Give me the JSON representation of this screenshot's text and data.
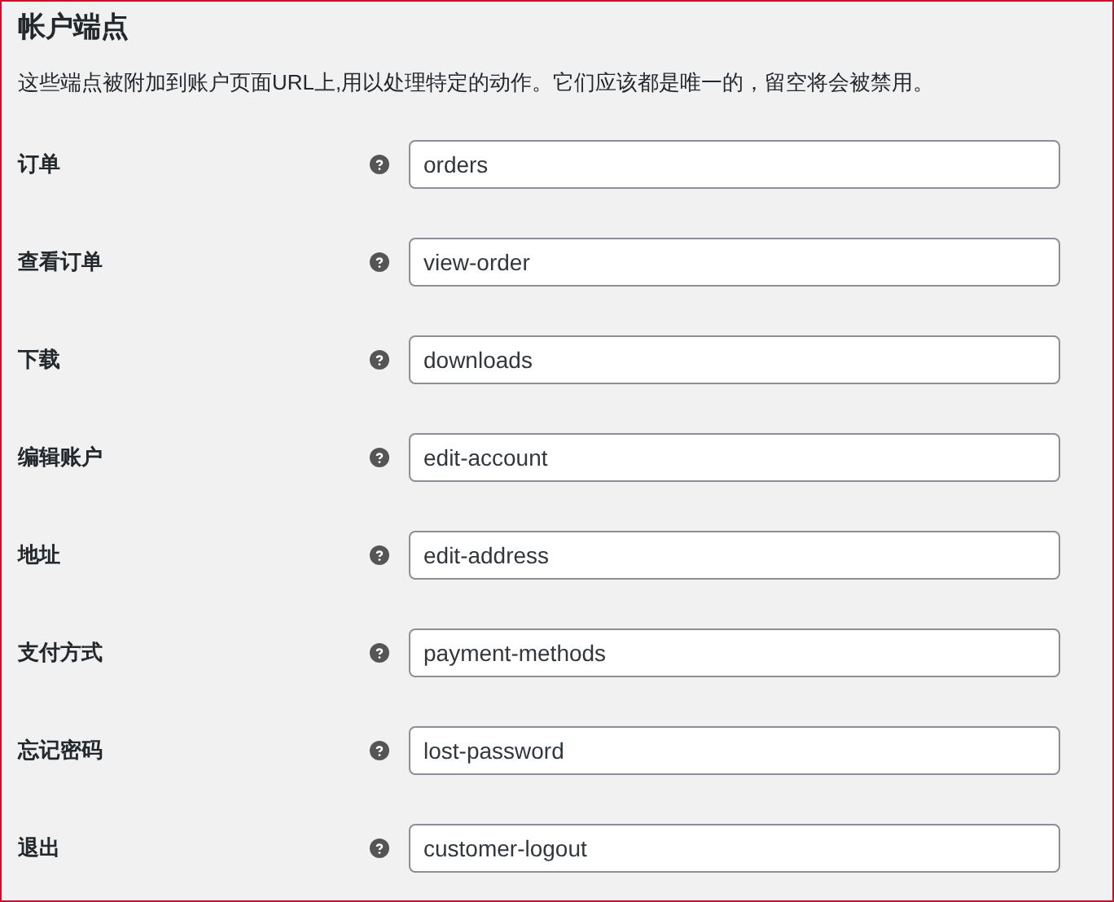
{
  "section": {
    "title": "帐户端点",
    "description": "这些端点被附加到账户页面URL上,用以处理特定的动作。它们应该都是唯一的，留空将会被禁用。"
  },
  "fields": [
    {
      "label": "订单",
      "value": "orders"
    },
    {
      "label": "查看订单",
      "value": "view-order"
    },
    {
      "label": "下载",
      "value": "downloads"
    },
    {
      "label": "编辑账户",
      "value": "edit-account"
    },
    {
      "label": "地址",
      "value": "edit-address"
    },
    {
      "label": "支付方式",
      "value": "payment-methods"
    },
    {
      "label": "忘记密码",
      "value": "lost-password"
    },
    {
      "label": "退出",
      "value": "customer-logout"
    }
  ]
}
